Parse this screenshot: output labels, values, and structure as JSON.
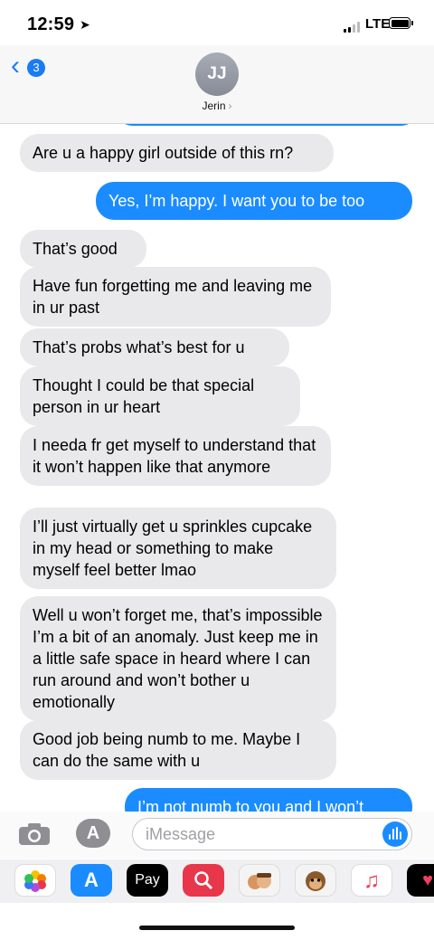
{
  "status": {
    "time": "12:59",
    "network": "LTE"
  },
  "header": {
    "back_count": "3",
    "avatar_initials": "JJ",
    "contact_name": "Jerin",
    "contact_arrow": "›"
  },
  "messages": [
    {
      "dir": "in",
      "text": "Are u a happy girl outside of this rn?"
    },
    {
      "dir": "out",
      "text": "Yes, I’m happy. I want you to be too"
    },
    {
      "dir": "in",
      "text": "That’s good"
    },
    {
      "dir": "in",
      "text": "Have fun forgetting me and leaving me in ur past"
    },
    {
      "dir": "in",
      "text": "That’s probs what’s best for u"
    },
    {
      "dir": "in",
      "text": "Thought I could be that special person in ur heart"
    },
    {
      "dir": "in",
      "text": "I needa fr get myself to understand that it won’t happen like that anymore"
    },
    {
      "dir": "in",
      "text": "I’ll just virtually get u sprinkles cupcake in my head or something to make myself feel better lmao"
    },
    {
      "dir": "in",
      "text": "Well u won’t  forget me, that’s impossible I’m a bit of an anomaly. Just keep me in a little safe space in heard  where I can run around and won’t bother u emotionally"
    },
    {
      "dir": "in",
      "text": "Good job being numb to me. Maybe I can do the same with u"
    },
    {
      "dir": "out",
      "text": "I’m not numb to you and I won’t"
    }
  ],
  "input": {
    "placeholder": "iMessage"
  },
  "apps": {
    "photos": "photos-icon",
    "appstore": "appstore-icon",
    "applepay": "Pay",
    "search": "web-search-icon",
    "memoji": "memoji-icon",
    "animoji": "animoji-icon",
    "music": "music-icon",
    "heart": "digital-touch-icon"
  },
  "colors": {
    "accent": "#1a8cff",
    "incoming": "#e9e9eb"
  }
}
